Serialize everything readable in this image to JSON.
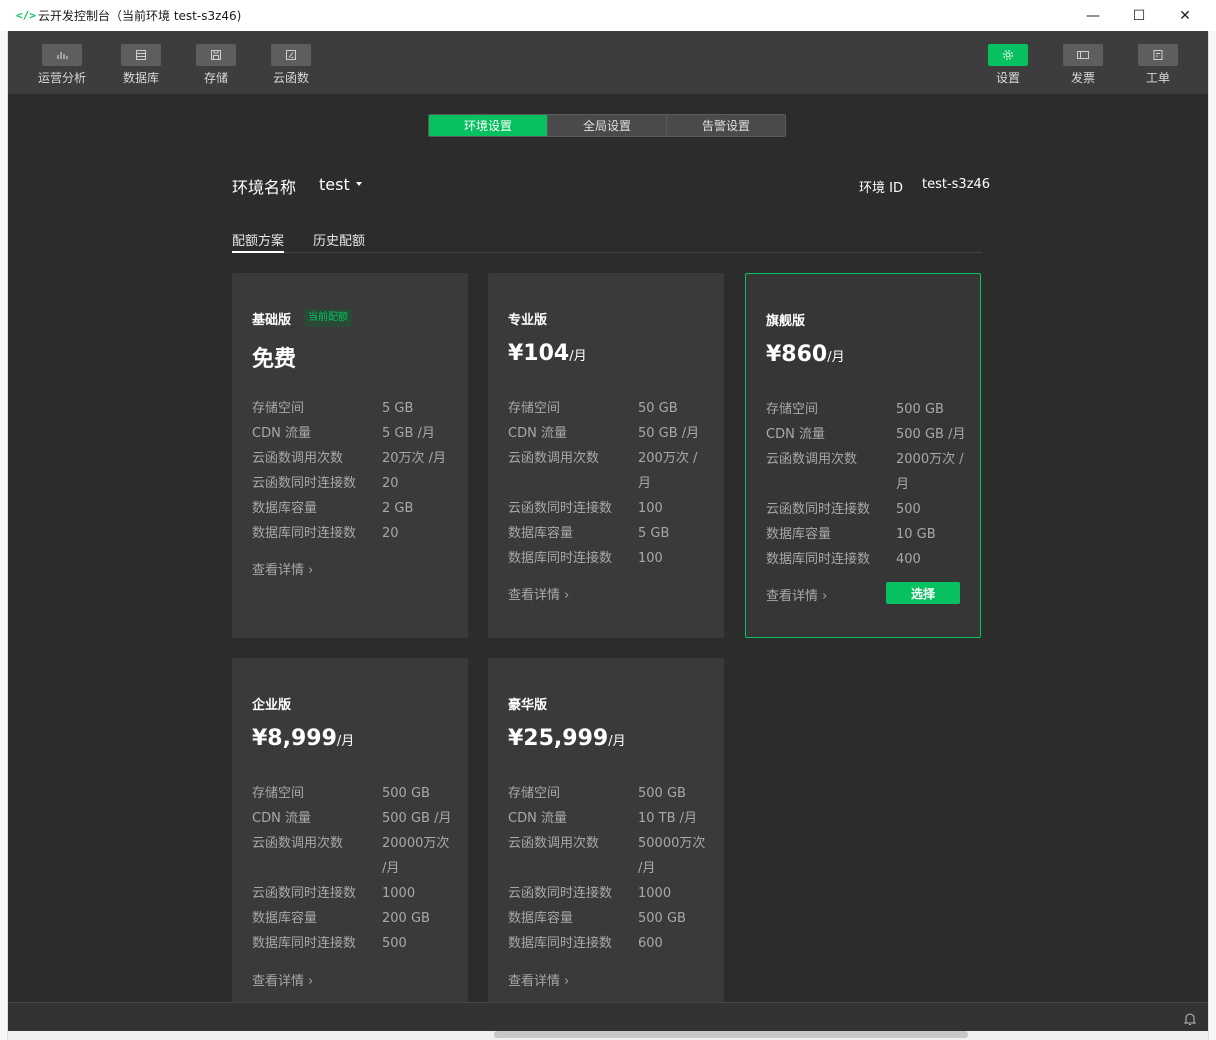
{
  "window": {
    "title": "云开发控制台（当前环境 test-s3z46)",
    "icon_text": "</>",
    "controls": {
      "minimize": "—",
      "maximize": "☐",
      "close": "✕"
    }
  },
  "toolbar": {
    "left": [
      {
        "label": "运营分析",
        "icon": "bar-chart-icon"
      },
      {
        "label": "数据库",
        "icon": "database-icon"
      },
      {
        "label": "存储",
        "icon": "storage-icon"
      },
      {
        "label": "云函数",
        "icon": "function-icon"
      }
    ],
    "right": [
      {
        "label": "设置",
        "icon": "gear-icon",
        "active": true
      },
      {
        "label": "发票",
        "icon": "invoice-icon"
      },
      {
        "label": "工单",
        "icon": "ticket-icon"
      }
    ]
  },
  "settings_tabs": [
    "环境设置",
    "全局设置",
    "告警设置"
  ],
  "env": {
    "name_label": "环境名称",
    "name": "test",
    "id_label": "环境 ID",
    "id": "test-s3z46"
  },
  "sub_tabs": [
    "配额方案",
    "历史配额"
  ],
  "plans": [
    {
      "name": "基础版",
      "badge": "当前配额",
      "price": "免费",
      "unit": "",
      "rows": [
        [
          "存储空间",
          "5 GB"
        ],
        [
          "CDN 流量",
          "5 GB /月"
        ],
        [
          "云函数调用次数",
          "20万次 /月"
        ],
        [
          "云函数同时连接数",
          "20"
        ],
        [
          "数据库容量",
          "2 GB"
        ],
        [
          "数据库同时连接数",
          "20"
        ]
      ],
      "detail": "查看详情 ›"
    },
    {
      "name": "专业版",
      "price": "¥104",
      "unit": "/月",
      "rows": [
        [
          "存储空间",
          "50 GB"
        ],
        [
          "CDN 流量",
          "50 GB /月"
        ],
        [
          "云函数调用次数",
          "200万次 / 月"
        ],
        [
          "云函数同时连接数",
          "100"
        ],
        [
          "数据库容量",
          "5 GB"
        ],
        [
          "数据库同时连接数",
          "100"
        ]
      ],
      "detail": "查看详情 ›"
    },
    {
      "name": "旗舰版",
      "price": "¥860",
      "unit": "/月",
      "rows": [
        [
          "存储空间",
          "500 GB"
        ],
        [
          "CDN 流量",
          "500 GB /月"
        ],
        [
          "云函数调用次数",
          "2000万次 / 月"
        ],
        [
          "云函数同时连接数",
          "500"
        ],
        [
          "数据库容量",
          "10 GB"
        ],
        [
          "数据库同时连接数",
          "400"
        ]
      ],
      "detail": "查看详情 ›",
      "select_label": "选择"
    },
    {
      "name": "企业版",
      "price": "¥8,999",
      "unit": "/月",
      "rows": [
        [
          "存储空间",
          "500 GB"
        ],
        [
          "CDN 流量",
          "500 GB /月"
        ],
        [
          "云函数调用次数",
          "20000万次 /月"
        ],
        [
          "云函数同时连接数",
          "1000"
        ],
        [
          "数据库容量",
          "200 GB"
        ],
        [
          "数据库同时连接数",
          "500"
        ]
      ],
      "detail": "查看详情 ›"
    },
    {
      "name": "豪华版",
      "price": "¥25,999",
      "unit": "/月",
      "rows": [
        [
          "存储空间",
          "500 GB"
        ],
        [
          "CDN 流量",
          "10 TB /月"
        ],
        [
          "云函数调用次数",
          "50000万次 /月"
        ],
        [
          "云函数同时连接数",
          "1000"
        ],
        [
          "数据库容量",
          "500 GB"
        ],
        [
          "数据库同时连接数",
          "600"
        ]
      ],
      "detail": "查看详情 ›"
    }
  ],
  "colors": {
    "accent": "#07c160",
    "panel": "#2c2c2c",
    "card": "#3a3a3a"
  }
}
